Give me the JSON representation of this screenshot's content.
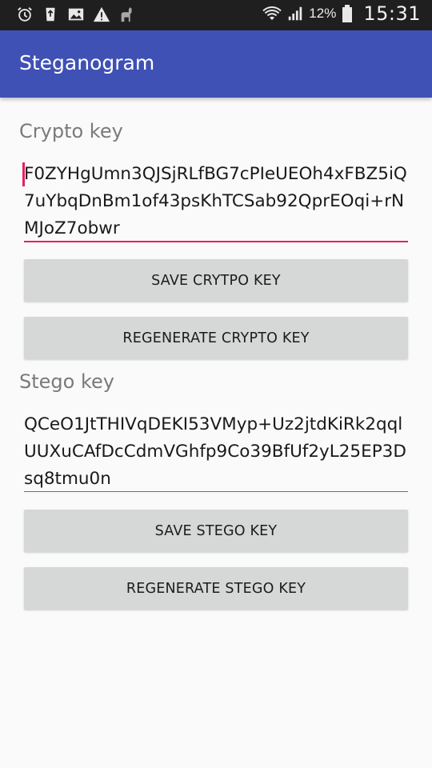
{
  "status_bar": {
    "battery_percent": "12%",
    "time": "15:31",
    "notification_icons": [
      "alarm-icon",
      "recycle-bin-icon",
      "image-icon",
      "warning-icon",
      "llama-icon"
    ],
    "system_icons": [
      "wifi-icon",
      "signal-icon",
      "battery-icon"
    ]
  },
  "app_bar": {
    "title": "Steganogram",
    "color": "#3f51b5"
  },
  "crypto": {
    "label": "Crypto key",
    "value": "F0ZYHgUmn3QJSjRLfBG7cPIeUEOh4xFBZ5iQ7uYbqDnBm1of43psKhTCSab92QprEOqi+rNMJoZ7obwr",
    "focused": true,
    "accent_color": "#e91e63",
    "save_label": "SAVE CRYTPO KEY",
    "regenerate_label": "REGENERATE CRYPTO KEY"
  },
  "stego": {
    "label": "Stego key",
    "value": "QCeO1JtTHIVqDEKI53VMyp+Uz2jtdKiRk2qqlUUXuCAfDcCdmVGhfp9Co39BfUf2yL25EP3Dsq8tmu0n",
    "focused": false,
    "save_label": "SAVE STEGO KEY",
    "regenerate_label": "REGENERATE STEGO KEY"
  }
}
